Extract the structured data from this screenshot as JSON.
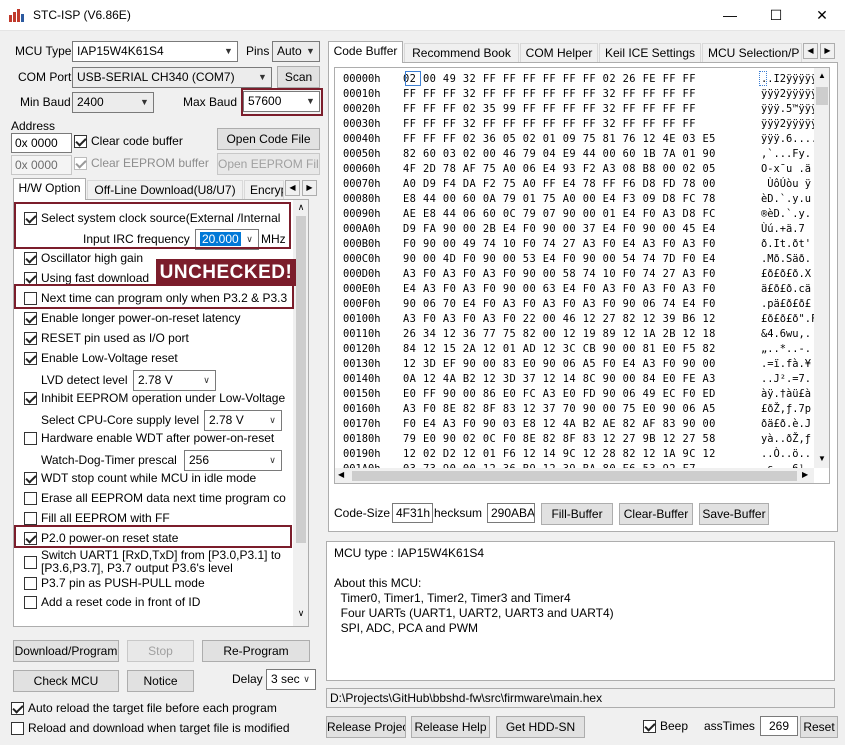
{
  "window": {
    "title": "STC-ISP (V6.86E)",
    "minimize_glyph": "—",
    "maximize_glyph": "☐",
    "close_glyph": "✕"
  },
  "left": {
    "mcu_type_label": "MCU Type",
    "mcu_type_value": "IAP15W4K61S4",
    "pins_label": "Pins",
    "pins_value": "Auto",
    "com_port_label": "COM Port",
    "com_port_value": "USB-SERIAL CH340 (COM7)",
    "scan_label": "Scan",
    "min_baud_label": "Min Baud",
    "min_baud_value": "2400",
    "max_baud_label": "Max Baud",
    "max_baud_value": "57600",
    "address_label": "Address",
    "address1_value": "0x 0000",
    "clear_code_label": "Clear code buffer",
    "open_code_label": "Open Code File",
    "address2_value": "0x 0000",
    "clear_eeprom_label": "Clear EEPROM buffer",
    "open_eeprom_label": "Open EEPROM File",
    "tabs": [
      "H/W Option",
      "Off-Line Download(U8/U7)",
      "Encryp"
    ],
    "hw": {
      "select_clock_label": "Select system clock source(External /Internal",
      "irc_label": "Input IRC frequency",
      "irc_value": "20.000",
      "irc_unit": "MHz",
      "osc_high_gain": "Oscillator high gain",
      "fast_download": "Using fast download",
      "unchecked_badge": "UNCHECKED!",
      "next_time": "Next time can program only when P3.2 & P3.3",
      "longer_por": "Enable longer power-on-reset latency",
      "reset_pin": "RESET pin used as I/O port",
      "low_voltage": "Enable Low-Voltage reset",
      "lvd_label": "LVD detect level",
      "lvd_value": "2.78 V",
      "inhibit_eeprom": "Inhibit EEPROM operation under Low-Voltage",
      "core_supply_label": "Select CPU-Core supply level",
      "core_supply_value": "2.78 V",
      "hw_wdt": "Hardware enable WDT after power-on-reset",
      "wdt_prescal_label": "Watch-Dog-Timer prescal",
      "wdt_prescal_value": "256",
      "wdt_stop": "WDT stop count while MCU in idle mode",
      "erase_eeprom": "Erase all EEPROM data next time program co",
      "fill_eeprom": "Fill all EEPROM with FF",
      "p20_state": "P2.0 power-on reset state",
      "switch_uart_1": "Switch UART1 [RxD,TxD] from [P3.0,P3.1] to",
      "switch_uart_2": "[P3.6,P3.7], P3.7 output P3.6's level",
      "p37_pushpull": "P3.7 pin as PUSH-PULL mode",
      "add_reset": "Add a reset code in front of ID"
    },
    "download_label": "Download/Program",
    "stop_label": "Stop",
    "reprogram_label": "Re-Program",
    "check_mcu_label": "Check MCU",
    "notice_label": "Notice",
    "delay_label": "Delay",
    "delay_value": "3 sec",
    "auto_reload": "Auto reload the target file before each program",
    "reload_modified": "Reload and download when target file is modified"
  },
  "right": {
    "tabs": [
      "Code Buffer",
      "Recommend Book",
      "COM Helper",
      "Keil ICE Settings",
      "MCU Selection/P"
    ],
    "hex_rows": [
      {
        "addr": "00000h",
        "bytes": "02 00 49 32 FF FF FF FF FF FF 02 26 FE FF FF",
        "ascii": "..I2ÿÿÿÿÿ"
      },
      {
        "addr": "00010h",
        "bytes": "FF FF FF 32 FF FF FF FF FF FF 32 FF FF FF FF",
        "ascii": "ÿÿÿ2ÿÿÿÿÿ"
      },
      {
        "addr": "00020h",
        "bytes": "FF FF FF 02 35 99 FF FF FF FF 32 FF FF FF FF",
        "ascii": "ÿÿÿ.5™ÿÿÿ"
      },
      {
        "addr": "00030h",
        "bytes": "FF FF FF 32 FF FF FF FF FF FF 32 FF FF FF FF",
        "ascii": "ÿÿÿ2ÿÿÿÿÿ"
      },
      {
        "addr": "00040h",
        "bytes": "FF FF FF 02 36 05 02 01 09 75 81 76 12 4E 03 E5",
        "ascii": "ÿÿÿ.6...."
      },
      {
        "addr": "00050h",
        "bytes": "82 60 03 02 00 46 79 04 E9 44 00 60 1B 7A 01 90",
        "ascii": ",`...Fy."
      },
      {
        "addr": "00060h",
        "bytes": "4F 2D 78 AF 75 A0 06 E4 93 F2 A3 08 B8 00 02 05",
        "ascii": "O-x¯u .ä"
      },
      {
        "addr": "00070h",
        "bytes": "A0 D9 F4 DA F2 75 A0 FF E4 78 FF F6 D8 FD 78 00",
        "ascii": " ÙôÚòu ÿ"
      },
      {
        "addr": "00080h",
        "bytes": "E8 44 00 60 0A 79 01 75 A0 00 E4 F3 09 D8 FC 78",
        "ascii": "èD.`.y.u"
      },
      {
        "addr": "00090h",
        "bytes": "AE E8 44 06 60 0C 79 07 90 00 01 E4 F0 A3 D8 FC",
        "ascii": "®èD.`.y."
      },
      {
        "addr": "000A0h",
        "bytes": "D9 FA 90 00 2B E4 F0 90 00 37 E4 F0 90 00 45 E4",
        "ascii": "Ùú.+ä.7"
      },
      {
        "addr": "000B0h",
        "bytes": "F0 90 00 49 74 10 F0 74 27 A3 F0 E4 A3 F0 A3 F0",
        "ascii": "ð.It.ðt'"
      },
      {
        "addr": "000C0h",
        "bytes": "90 00 4D F0 90 00 53 E4 F0 90 00 54 74 7D F0 E4",
        "ascii": ".Mð.Säð."
      },
      {
        "addr": "000D0h",
        "bytes": "A3 F0 A3 F0 A3 F0 90 00 58 74 10 F0 74 27 A3 F0",
        "ascii": "£ð£ð£ð.X"
      },
      {
        "addr": "000E0h",
        "bytes": "E4 A3 F0 A3 F0 90 00 63 E4 F0 A3 F0 A3 F0 A3 F0",
        "ascii": "ä£ð£ð.cä"
      },
      {
        "addr": "000F0h",
        "bytes": "90 06 70 E4 F0 A3 F0 A3 F0 A3 F0 90 06 74 E4 F0",
        "ascii": ".pä£ð£ð£"
      },
      {
        "addr": "00100h",
        "bytes": "A3 F0 A3 F0 A3 F0 22 00 46 12 27 82 12 39 B6 12",
        "ascii": "£ð£ð£ð\".F"
      },
      {
        "addr": "00110h",
        "bytes": "26 34 12 36 77 75 82 00 12 19 89 12 1A 2B 12 18",
        "ascii": "&4.6wu,."
      },
      {
        "addr": "00120h",
        "bytes": "84 12 15 2A 12 01 AD 12 3C CB 90 00 81 E0 F5 82",
        "ascii": "„..*..-."
      },
      {
        "addr": "00130h",
        "bytes": "12 3D EF 90 00 83 E0 90 06 A5 F0 E4 A3 F0 90 00",
        "ascii": ".=ï.fà.¥"
      },
      {
        "addr": "00140h",
        "bytes": "0A 12 4A B2 12 3D 37 12 14 8C 90 00 84 E0 FE A3",
        "ascii": "..J².=7."
      },
      {
        "addr": "00150h",
        "bytes": "E0 FF 90 00 86 E0 FC A3 E0 FD 90 06 49 EC F0 ED",
        "ascii": "àÿ.†àü£à"
      },
      {
        "addr": "00160h",
        "bytes": "A3 F0 8E 82 8F 83 12 37 70 90 00 75 E0 90 06 A5",
        "ascii": "£ðŽ‚ƒ.7p"
      },
      {
        "addr": "00170h",
        "bytes": "F0 E4 A3 F0 90 03 E8 12 4A B2 AE 82 AF 83 90 00",
        "ascii": "ðä£ð.è.J"
      },
      {
        "addr": "00180h",
        "bytes": "79 E0 90 02 0C F0 8E 82 8F 83 12 27 9B 12 27 58",
        "ascii": "yà..ðŽ‚ƒ"
      },
      {
        "addr": "00190h",
        "bytes": "12 02 D2 12 01 F6 12 14 9C 12 28 82 12 1A 9C 12",
        "ascii": "..Ò..ö.."
      },
      {
        "addr": "001A0h",
        "bytes": "03 73 90 00 12 36 B9 12 39 BA 80 E6 53 92 F7",
        "ascii": ".s...6¹."
      }
    ],
    "code_size_label": "Code-Size",
    "code_size_value": "4F31h",
    "checksum_label": "hecksum",
    "checksum_value": "290ABA",
    "fill_buffer_label": "Fill-Buffer",
    "clear_buffer_label": "Clear-Buffer",
    "save_buffer_label": "Save-Buffer",
    "info_text": "MCU type : IAP15W4K61S4\n\nAbout this MCU:\n  Timer0, Timer1, Timer2, Timer3 and Timer4\n  Four UARTs (UART1, UART2, UART3 and UART4)\n  SPI, ADC, PCA and PWM",
    "file_path": "D:\\Projects\\GitHub\\bbshd-fw\\src\\firmware\\main.hex",
    "release_project_label": "Release Project",
    "release_help_label": "Release Help",
    "get_hddsn_label": "Get HDD-SN",
    "beep_label": "Beep",
    "pass_times_label": "assTimes",
    "pass_times_value": "269",
    "reset_label": "Reset"
  },
  "colors": {
    "annotation": "#7b1d2b",
    "selection": "#0078d7"
  }
}
